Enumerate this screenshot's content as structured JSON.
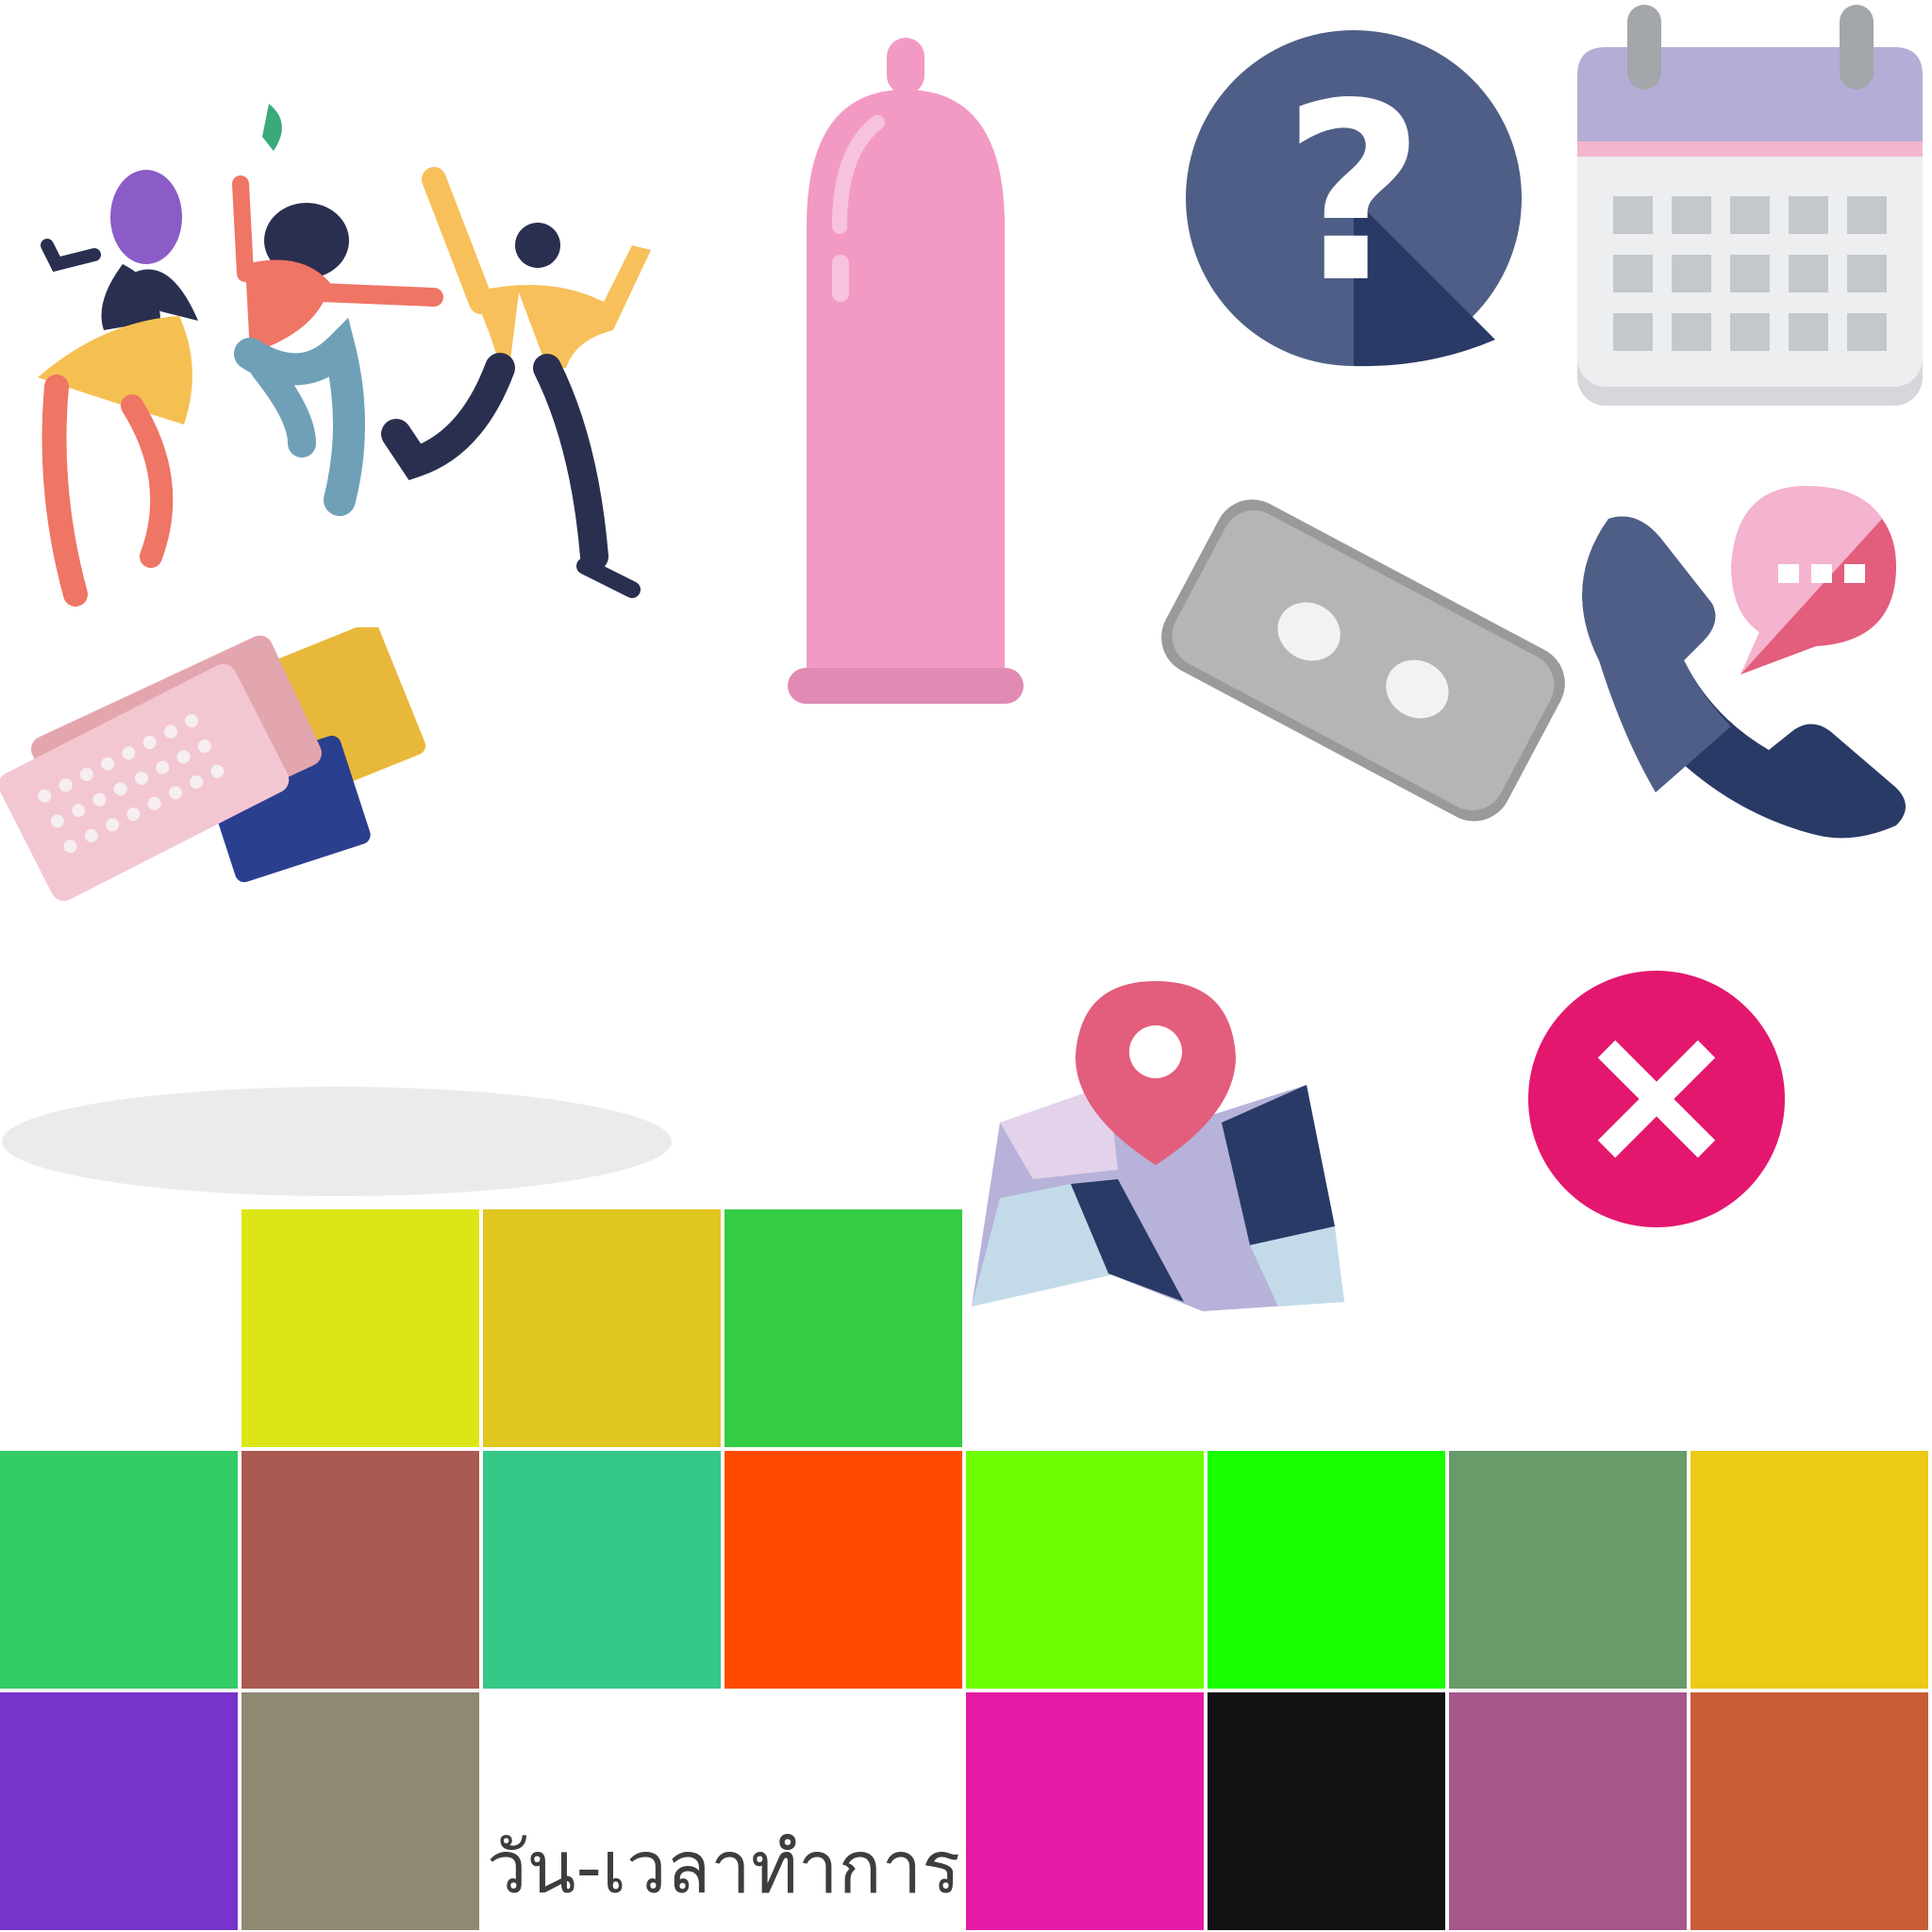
{
  "sticker_sheet": {
    "caption": "วัน-เวลาทำการ",
    "icons": [
      "dancing-people-illustration",
      "condom-icon",
      "question-icon",
      "calendar-icon",
      "birth-control-pill-packs-icon",
      "emergency-pill-blister-icon",
      "phone-chat-icon",
      "map-pin-icon",
      "close-icon",
      "shadow-ellipse"
    ],
    "palette_rows": [
      [
        "",
        "#DCE616",
        "#E0C61E",
        "#33CC44",
        "",
        "",
        "",
        ""
      ],
      [
        "#33CC66",
        "#AA5A52",
        "#36C887",
        "#FF4B00",
        "#6CFF00",
        "#18FF00",
        "#679B6A",
        "#EBCB16"
      ],
      [
        "#7733CC",
        "#8E8972",
        "",
        "",
        "#E51AA6",
        "#111211",
        "#A6578C",
        "#C95D38"
      ]
    ]
  }
}
